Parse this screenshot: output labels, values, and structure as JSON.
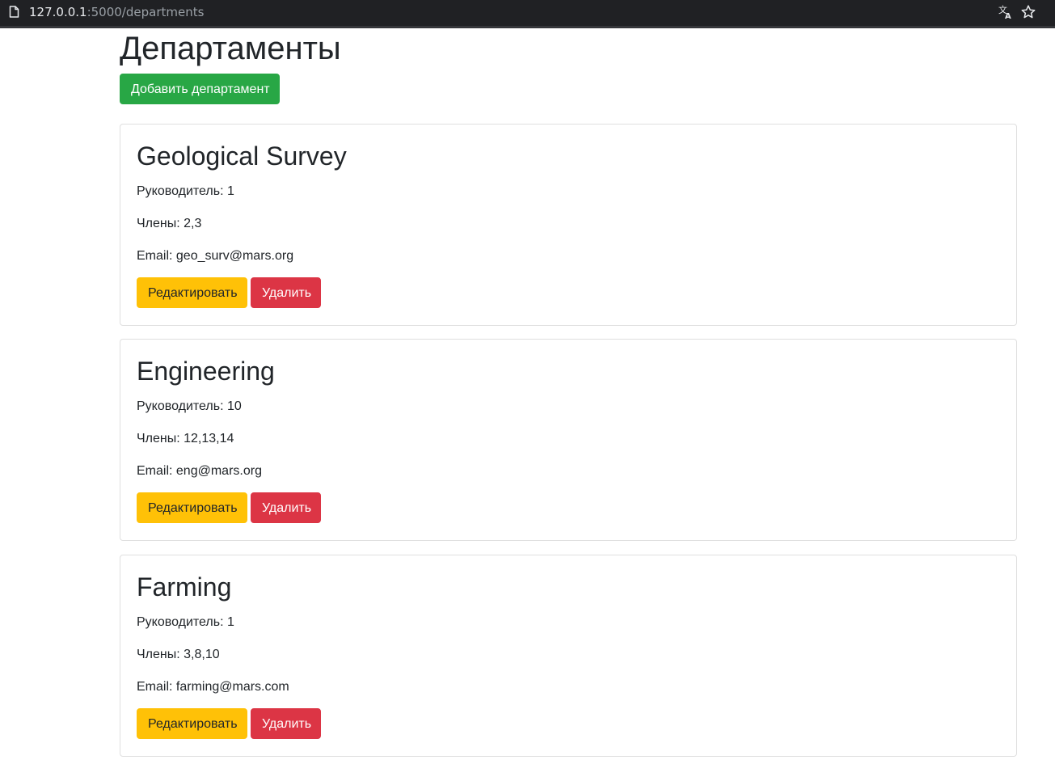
{
  "browser": {
    "url_host": "127.0.0.1",
    "url_path": ":5000/departments",
    "icons": [
      "page-icon",
      "translate-icon",
      "star-icon"
    ]
  },
  "page": {
    "title": "Департаменты",
    "add_button": "Добавить департамент"
  },
  "departments": [
    {
      "name": "Geological Survey",
      "leader": "Руководитель: 1",
      "members": "Члены: 2,3",
      "email": "Email: geo_surv@mars.org",
      "edit_label": "Редактировать",
      "delete_label": "Удалить"
    },
    {
      "name": "Engineering",
      "leader": "Руководитель: 10",
      "members": "Члены: 12,13,14",
      "email": "Email: eng@mars.org",
      "edit_label": "Редактировать",
      "delete_label": "Удалить"
    },
    {
      "name": "Farming",
      "leader": "Руководитель: 1",
      "members": "Члены: 3,8,10",
      "email": "Email: farming@mars.com",
      "edit_label": "Редактировать",
      "delete_label": "Удалить"
    }
  ],
  "colors": {
    "success": "#28a745",
    "warning": "#ffc107",
    "danger": "#dc3545",
    "text": "#212529",
    "card_border": "#dfdfdf",
    "browser_bar": "#202124"
  }
}
